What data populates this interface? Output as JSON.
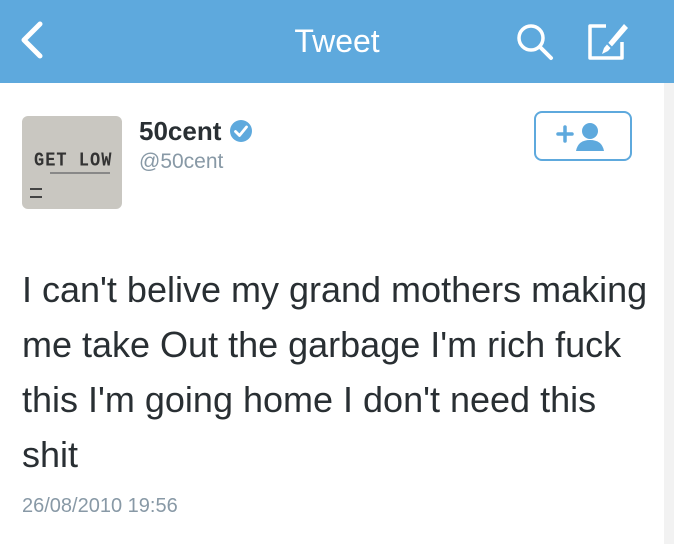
{
  "navbar": {
    "title": "Tweet",
    "background": "#5ea9dd",
    "back_icon": "chevron-left-icon",
    "search_icon": "search-icon",
    "compose_icon": "compose-icon"
  },
  "tweet": {
    "avatar": {
      "description_text": "GET LOW",
      "icon": "avatar"
    },
    "author_name": "50cent",
    "verified_icon": "verified-badge-icon",
    "handle": "@50cent",
    "follow_icon": "follow-user-icon",
    "text": "I can't belive my grand mothers making me take Out the garbage I'm rich fuck this I'm going home I don't need this shit",
    "timestamp": "26/08/2010 19:56"
  },
  "colors": {
    "accent": "#5ea9dd",
    "text": "#292f33",
    "muted": "#8899a6"
  }
}
